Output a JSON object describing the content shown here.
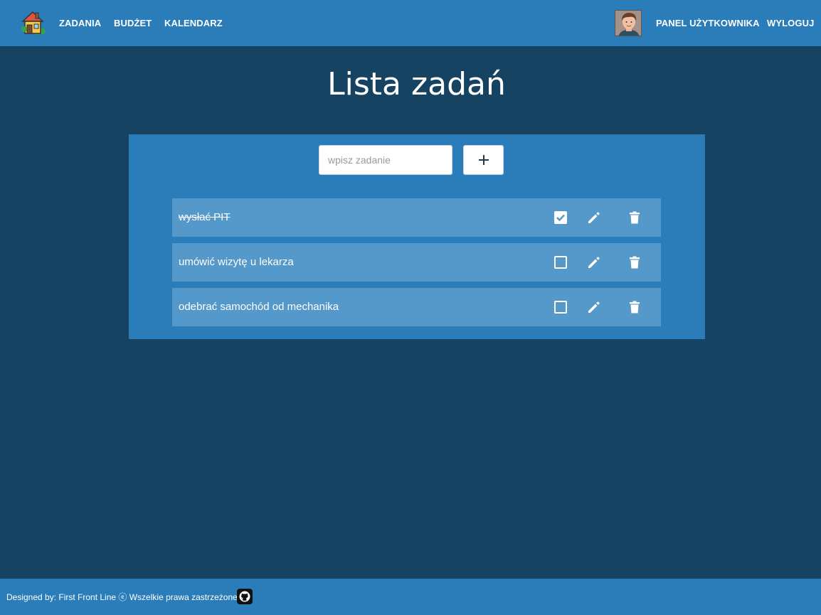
{
  "nav": {
    "logo_icon": "house-icon",
    "links": [
      "ZADANIA",
      "BUDŻET",
      "KALENDARZ"
    ],
    "user_panel_label": "PANEL UŻYTKOWNIKA",
    "logout_label": "WYLOGUJ"
  },
  "main": {
    "title": "Lista zadań",
    "input": {
      "placeholder": "wpisz zadanie",
      "value": ""
    },
    "add_label": "+",
    "tasks": [
      {
        "text": "wysłać PIT",
        "done": true
      },
      {
        "text": "umówić wizytę u lekarza",
        "done": false
      },
      {
        "text": "odebrać samochód od mechanika",
        "done": false
      }
    ]
  },
  "footer": {
    "text": "Designed by: First Front Line ⓔ Wszelkie prawa zastrzeżone.",
    "github_icon": "github-icon"
  },
  "colors": {
    "background": "#174362",
    "bar": "#2a7db8",
    "task_row": "#5499c9"
  }
}
